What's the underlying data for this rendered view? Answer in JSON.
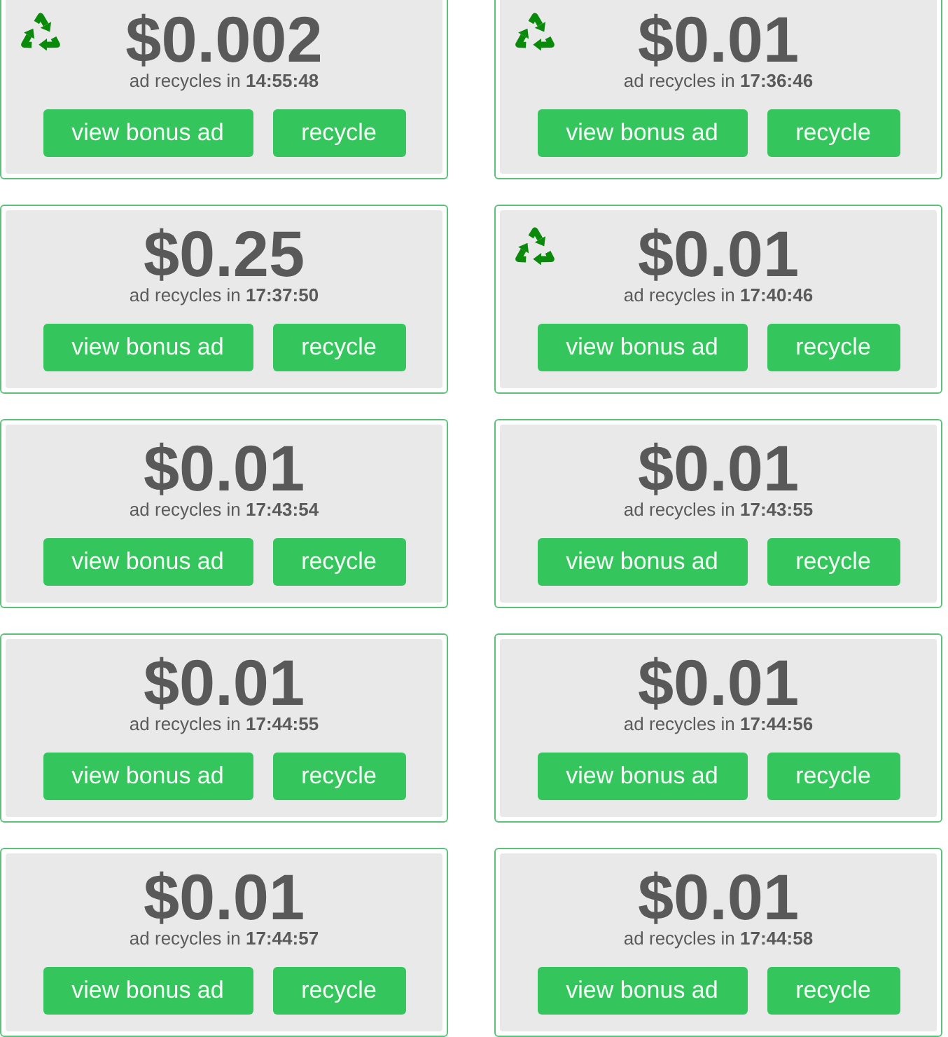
{
  "ads": [
    {
      "reward": "$0.002",
      "countdown": "ad recycles in **14:55:48**",
      "recycled": true,
      "view_button": "view bonus ad",
      "recycle_button": "recycle"
    },
    {
      "reward": "$0.01",
      "countdown": "ad recycles in **17:36:46**",
      "recycled": true,
      "view_button": "view bonus ad",
      "recycle_button": "recycle"
    },
    {
      "reward": "$0.25",
      "countdown": "ad recycles in **17:37:50**",
      "recycled": false,
      "view_button": "view bonus ad",
      "recycle_button": "recycle"
    },
    {
      "reward": "$0.01",
      "countdown": "ad recycles in **17:40:46**",
      "recycled": true,
      "view_button": "view bonus ad",
      "recycle_button": "recycle"
    },
    {
      "reward": "$0.01",
      "countdown": "ad recycles in **17:43:54**",
      "recycled": false,
      "view_button": "view bonus ad",
      "recycle_button": "recycle"
    },
    {
      "reward": "$0.01",
      "countdown": "ad recycles in **17:43:55**",
      "recycled": false,
      "view_button": "view bonus ad",
      "recycle_button": "recycle"
    },
    {
      "reward": "$0.01",
      "countdown": "ad recycles in **17:44:55**",
      "recycled": false,
      "view_button": "view bonus ad",
      "recycle_button": "recycle"
    },
    {
      "reward": "$0.01",
      "countdown": "ad recycles in **17:44:56**",
      "recycled": false,
      "view_button": "view bonus ad",
      "recycle_button": "recycle"
    },
    {
      "reward": "$0.01",
      "countdown": "ad recycles in **17:44:57**",
      "recycled": false,
      "view_button": "view bonus ad",
      "recycle_button": "recycle"
    },
    {
      "reward": "$0.01",
      "countdown": "ad recycles in **17:44:58**",
      "recycled": false,
      "view_button": "view bonus ad",
      "recycle_button": "recycle"
    }
  ]
}
